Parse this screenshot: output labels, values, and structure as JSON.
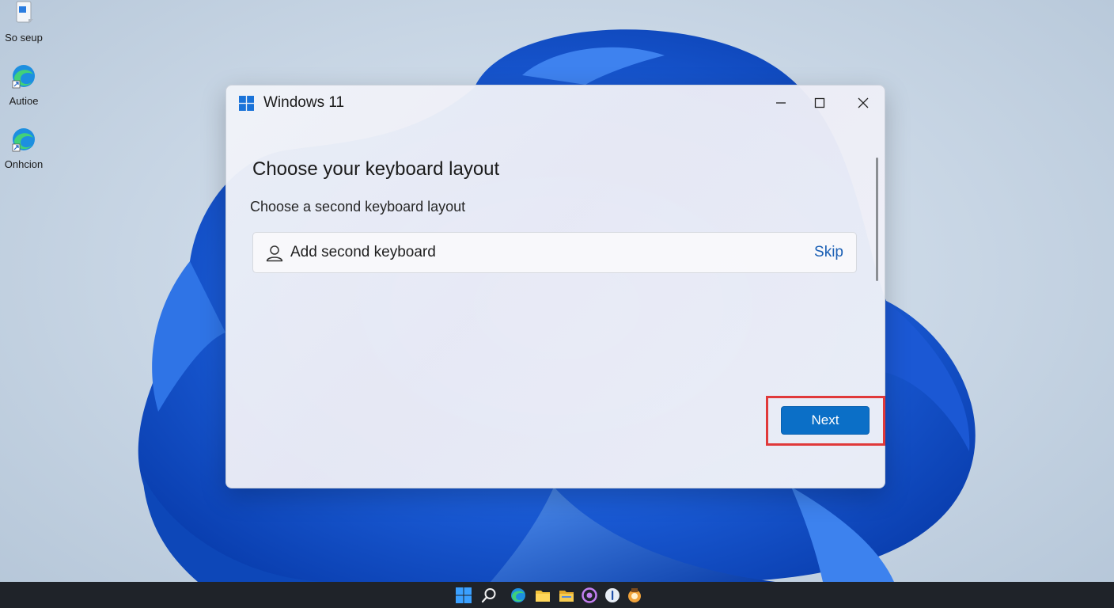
{
  "desktop": {
    "icons": [
      {
        "label": "So seup",
        "icon": "setup-icon"
      },
      {
        "label": "Autioe",
        "icon": "edge-icon"
      },
      {
        "label": "Onhcion",
        "icon": "edge-icon"
      }
    ]
  },
  "dialog": {
    "title": "Windows 11",
    "heading": "Choose your keyboard layout",
    "subheading": "Choose a second keyboard layout",
    "add_keyboard_label": "Add second keyboard",
    "skip_label": "Skip",
    "next_label": "Next"
  },
  "colors": {
    "accent": "#0b6fc7",
    "highlight": "#e0393a",
    "taskbar": "#1f2329"
  },
  "taskbar": {
    "icons": [
      "start-icon",
      "search-icon",
      "edge-icon",
      "file-explorer-icon",
      "folder-icon",
      "app-circle-icon",
      "info-icon",
      "app-icon"
    ]
  }
}
